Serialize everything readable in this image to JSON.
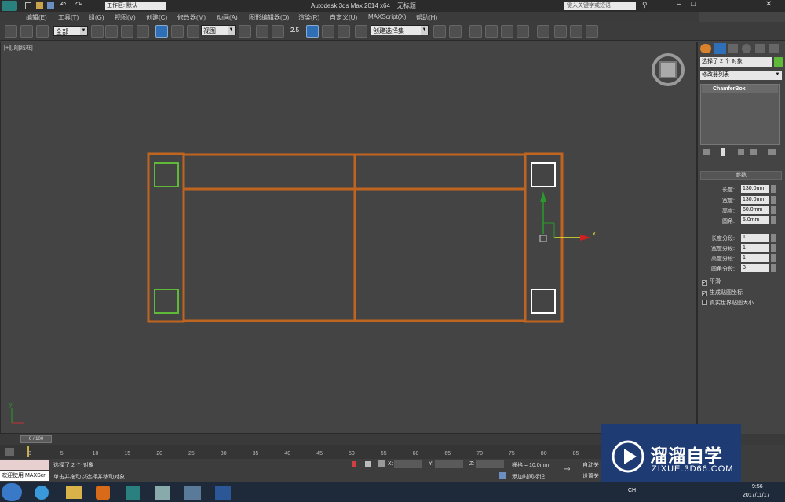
{
  "app": {
    "title": "Autodesk 3ds Max  2014 x64",
    "doc_title": "无标题",
    "workspace": "工作区: 默认",
    "search_placeholder": "键入关键字或短语"
  },
  "menu": [
    "编辑(E)",
    "工具(T)",
    "组(G)",
    "视图(V)",
    "创建(C)",
    "修改器(M)",
    "动画(A)",
    "图形编辑器(D)",
    "渲染(R)",
    "自定义(U)",
    "MAXScript(X)",
    "帮助(H)"
  ],
  "toolbar": {
    "filter": "全部",
    "ref_coord": "视图",
    "snap_label": "2.5",
    "named_selection": "创建选择集"
  },
  "viewport": {
    "label": "[+][顶][线框]",
    "axis_x": "x",
    "axis_y": "y"
  },
  "command_panel": {
    "selection_info": "选择了 2 个 对象",
    "modifier_list": "修改器列表",
    "stack_item": "ChamferBox",
    "rollout_title": "参数",
    "params": [
      {
        "label": "长度:",
        "value": "130.0mm"
      },
      {
        "label": "宽度:",
        "value": "130.0mm"
      },
      {
        "label": "高度:",
        "value": "60.0mm"
      },
      {
        "label": "圆角:",
        "value": "5.0mm"
      }
    ],
    "segments": [
      {
        "label": "长度分段:",
        "value": "1"
      },
      {
        "label": "宽度分段:",
        "value": "1"
      },
      {
        "label": "高度分段:",
        "value": "1"
      },
      {
        "label": "圆角分段:",
        "value": "3"
      }
    ],
    "checkboxes": [
      {
        "label": "平滑",
        "checked": true
      },
      {
        "label": "生成贴图坐标",
        "checked": true
      },
      {
        "label": "真实世界贴图大小",
        "checked": false
      }
    ]
  },
  "timeline": {
    "frame": "0 / 100",
    "ticks": [
      "0",
      "5",
      "10",
      "15",
      "20",
      "25",
      "30",
      "35",
      "40",
      "45",
      "50",
      "55",
      "60",
      "65",
      "70",
      "75",
      "80",
      "85"
    ]
  },
  "status": {
    "selection": "选择了 2 个 对象",
    "prompt": "单击并拖动以选择并移动对象",
    "maxscript": "欢迎使用  MAXScr",
    "x_label": "X:",
    "y_label": "Y:",
    "z_label": "Z:",
    "grid": "栅格 = 10.0mm",
    "add_time_tag": "添加时间标记",
    "auto_key": "自动关",
    "set_key": "设置关"
  },
  "taskbar": {
    "time": "9:56",
    "date": "2017/11/17",
    "lang": "CH"
  },
  "watermark": {
    "brand": "溜溜自学",
    "url": "ZIXUE.3D66.COM"
  },
  "colors": {
    "selection": "#c0651f",
    "green_box": "#5fba3a",
    "white_box": "#ffffff",
    "viewport_bg": "#444444"
  }
}
